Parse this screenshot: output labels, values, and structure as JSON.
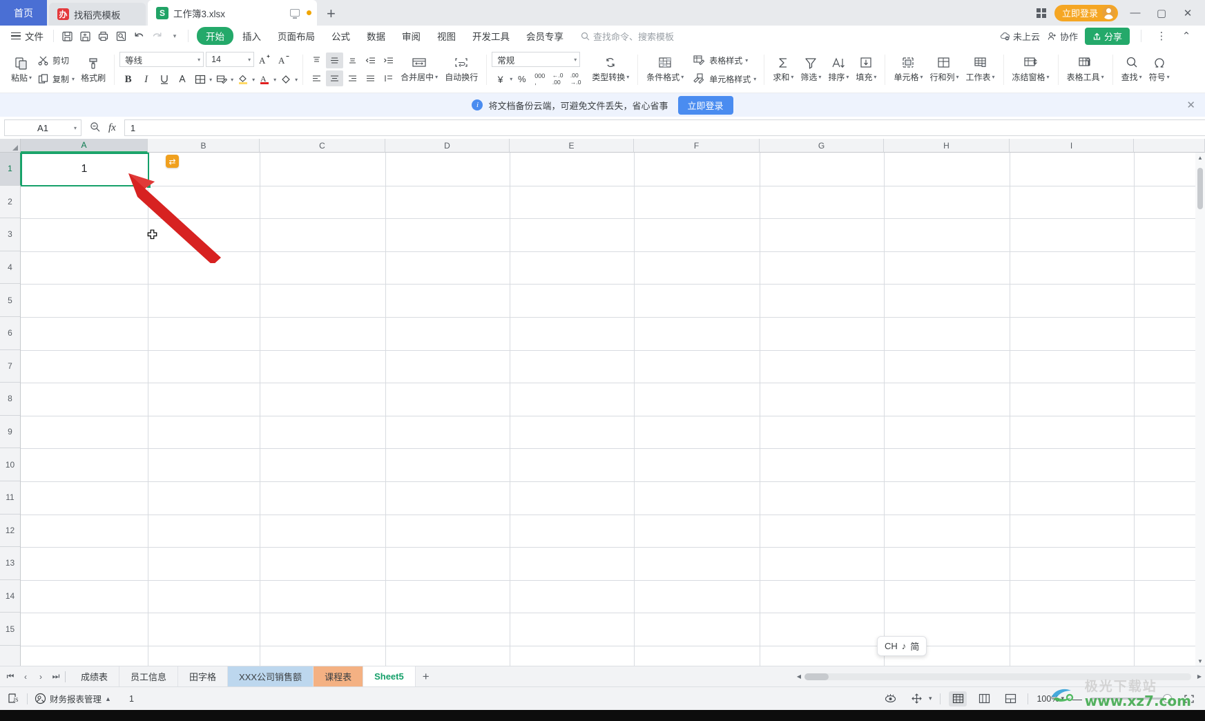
{
  "window": {
    "tabs": [
      {
        "label": "首页",
        "type": "home"
      },
      {
        "label": "找稻壳模板",
        "type": "template",
        "icon": "docer-icon"
      },
      {
        "label": "工作簿3.xlsx",
        "type": "doc",
        "icon": "spreadsheet-icon",
        "active": true
      }
    ],
    "new_tab_label": "+",
    "login_label": "立即登录",
    "minimize_label": "—",
    "maximize_label": "▢",
    "close_label": "✕"
  },
  "menubar": {
    "file_label": "文件",
    "quick_access": [
      "save-icon",
      "save-as-cloud-icon",
      "print-icon",
      "print-preview-icon",
      "undo-icon",
      "redo-icon",
      "customize-caret-icon"
    ],
    "items": [
      "开始",
      "插入",
      "页面布局",
      "公式",
      "数据",
      "审阅",
      "视图",
      "开发工具",
      "会员专享"
    ],
    "active_item": "开始",
    "search_placeholder": "查找命令、搜索模板",
    "cloud_status": "未上云",
    "collab_label": "协作",
    "share_label": "分享",
    "more_label": "⋮",
    "collapse_label": "⌃"
  },
  "ribbon": {
    "paste": "粘贴",
    "cut": "剪切",
    "copy": "复制",
    "format_painter": "格式刷",
    "font_name": "等线",
    "font_size": "14",
    "grow_font": "A⁺",
    "shrink_font": "A⁻",
    "bold": "B",
    "italic": "I",
    "underline": "U",
    "strikethrough": "A",
    "borders": "borders-icon",
    "more_format": "more-format-icon",
    "fill_color": "fill-color-icon",
    "font_color": "font-color-icon",
    "clear_format": "clear-format-icon",
    "merge_center": "合并居中",
    "wrap_text": "自动换行",
    "number_format": "常规",
    "currency": "¥",
    "percent": "%",
    "comma": "000",
    "dec_decrease": "←.0",
    "dec_increase": ".00",
    "type_convert": "类型转换",
    "conditional_format": "条件格式",
    "table_style": "表格样式",
    "cell_style": "单元格样式",
    "autosum": "求和",
    "filter": "筛选",
    "sort": "排序",
    "fill": "填充",
    "cells": "单元格",
    "rows_cols": "行和列",
    "worksheet": "工作表",
    "freeze_panes": "冻结窗格",
    "table_tools": "表格工具",
    "find": "查找",
    "symbol": "符号"
  },
  "banner": {
    "message": "将文档备份云端，可避免文件丢失，省心省事",
    "button": "立即登录",
    "close": "✕"
  },
  "formula_bar": {
    "name_box": "A1",
    "zoom_icon": "search-formula-icon",
    "fx": "fx",
    "value": "1"
  },
  "grid": {
    "columns": [
      "A",
      "B",
      "C",
      "D",
      "E",
      "F",
      "G",
      "H",
      "I"
    ],
    "rows": [
      "1",
      "2",
      "3",
      "4",
      "5",
      "6",
      "7",
      "8",
      "9",
      "10",
      "11",
      "12",
      "13",
      "14",
      "15"
    ],
    "selected_cell": "A1",
    "selected_column": "A",
    "selected_row": "1",
    "cell_a1_value": "1",
    "quick_analysis_badge": "⇄",
    "selection_color": "#15a06a"
  },
  "ime_tooltip": {
    "mode": "CH",
    "note": "♪",
    "lang": "简"
  },
  "sheet_tabs": {
    "nav": [
      "⏮",
      "‹",
      "›",
      "⏭"
    ],
    "tabs": [
      {
        "label": "成绩表",
        "color": ""
      },
      {
        "label": "员工信息",
        "color": ""
      },
      {
        "label": "田字格",
        "color": ""
      },
      {
        "label": "XXX公司销售额",
        "color": "#bdd7ee"
      },
      {
        "label": "课程表",
        "color": "#f4b183"
      },
      {
        "label": "Sheet5",
        "color": "",
        "active": true
      }
    ],
    "add_label": "+"
  },
  "status_bar": {
    "script_icon": "js-script-icon",
    "account_label": "财务报表管理",
    "account_caret": "▲",
    "count_value": "1",
    "eye_icon": "eye-icon",
    "move_icon": "move-icon",
    "view_modes": [
      "normal-view-icon",
      "page-layout-icon",
      "page-break-icon"
    ],
    "active_view": "normal-view-icon",
    "zoom_level": "100%",
    "zoom_minus": "—",
    "fullscreen_icon": "fullscreen-icon"
  },
  "watermark": {
    "cn": "极光下载站",
    "url": "www.xz7.com"
  }
}
